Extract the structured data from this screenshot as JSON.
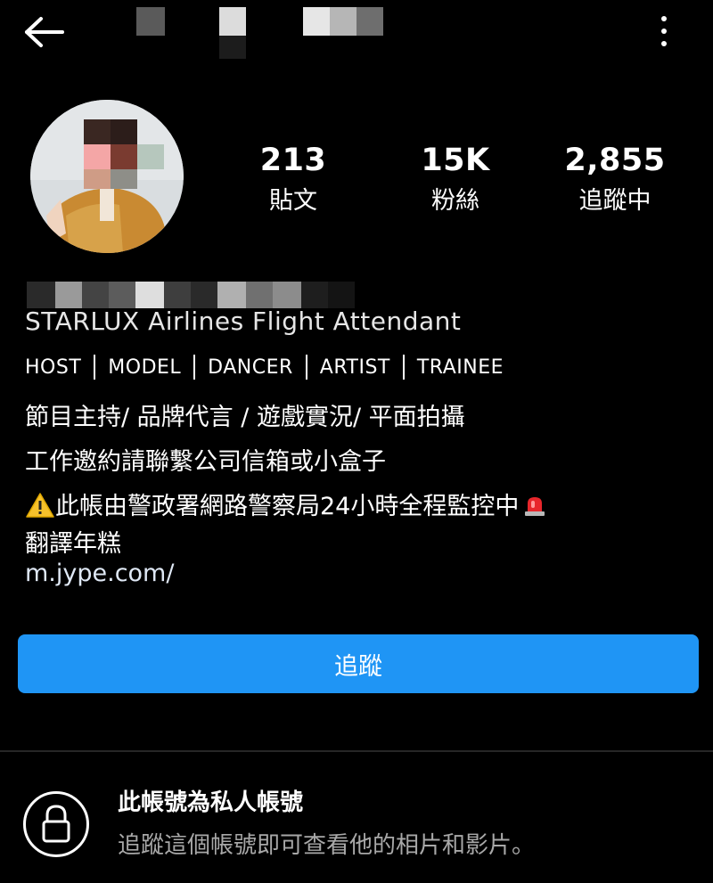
{
  "header": {
    "back_icon": "arrow-left-icon",
    "menu_icon": "more-vertical-icon"
  },
  "profile": {
    "stats": [
      {
        "value": "213",
        "label": "貼文"
      },
      {
        "value": "15K",
        "label": "粉絲"
      },
      {
        "value": "2,855",
        "label": "追蹤中"
      }
    ],
    "bio": {
      "tagline": "STARLUX Airlines Flight Attendant",
      "roles": [
        "HOST",
        "MODEL",
        "DANCER",
        "ARTIST",
        "TRAINEE"
      ],
      "line1": "節目主持/ 品牌代言 / 遊戲實況/ 平面拍攝",
      "line2": "工作邀約請聯繫公司信箱或小盒子",
      "warning": "此帳由警政署網路警察局24小時全程監控中",
      "translate": "翻譯年糕",
      "link": "m.jype.com/"
    }
  },
  "actions": {
    "follow_label": "追蹤"
  },
  "private_notice": {
    "icon": "lock-icon",
    "title": "此帳號為私人帳號",
    "description": "追蹤這個帳號即可查看他的相片和影片。"
  },
  "colors": {
    "background": "#000000",
    "follow_button": "#1f95f5",
    "secondary_text": "#a8a8a8"
  }
}
